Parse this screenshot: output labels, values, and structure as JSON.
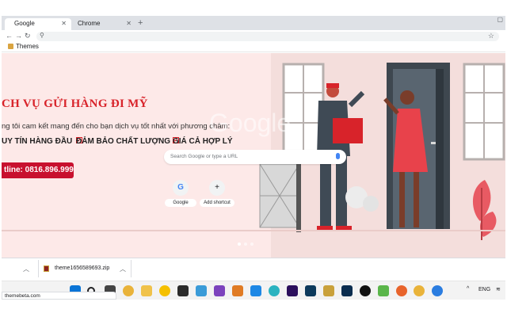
{
  "tabs": [
    {
      "label": "Google",
      "active": true
    },
    {
      "label": "Chrome",
      "active": false
    }
  ],
  "toolbar": {
    "back_icon": "arrow-left-icon",
    "forward_icon": "arrow-right-icon",
    "reload_icon": "reload-icon",
    "omnibox_value": ""
  },
  "bookmarks": [
    {
      "label": "Themes"
    }
  ],
  "theme": {
    "headline": "CH VỤ GỬI HÀNG ĐI MỸ",
    "subline": "ng tôi cam kết mang đến cho bạn dịch vụ tốt nhất với phương châm:",
    "features": [
      "UY TÍN HÀNG ĐẦU",
      "ĐẢM BẢO CHẤT LƯỢNG",
      "GIÁ CẢ HỢP LÝ"
    ],
    "hotline": "tline: 0816.896.999",
    "accent_color": "#d8232a",
    "background_color": "#fde9e8"
  },
  "ntp": {
    "logo": "Google",
    "search_placeholder": "Search Google or type a URL",
    "shortcuts": [
      {
        "label": "Google",
        "icon": "G"
      },
      {
        "label": "Add shortcut",
        "icon": "+"
      }
    ]
  },
  "downloads": [
    {
      "filename": "theme1656589693.zip"
    }
  ],
  "taskbar": {
    "language": "ENG"
  },
  "statusbar": {
    "text": "themebeta.com"
  }
}
